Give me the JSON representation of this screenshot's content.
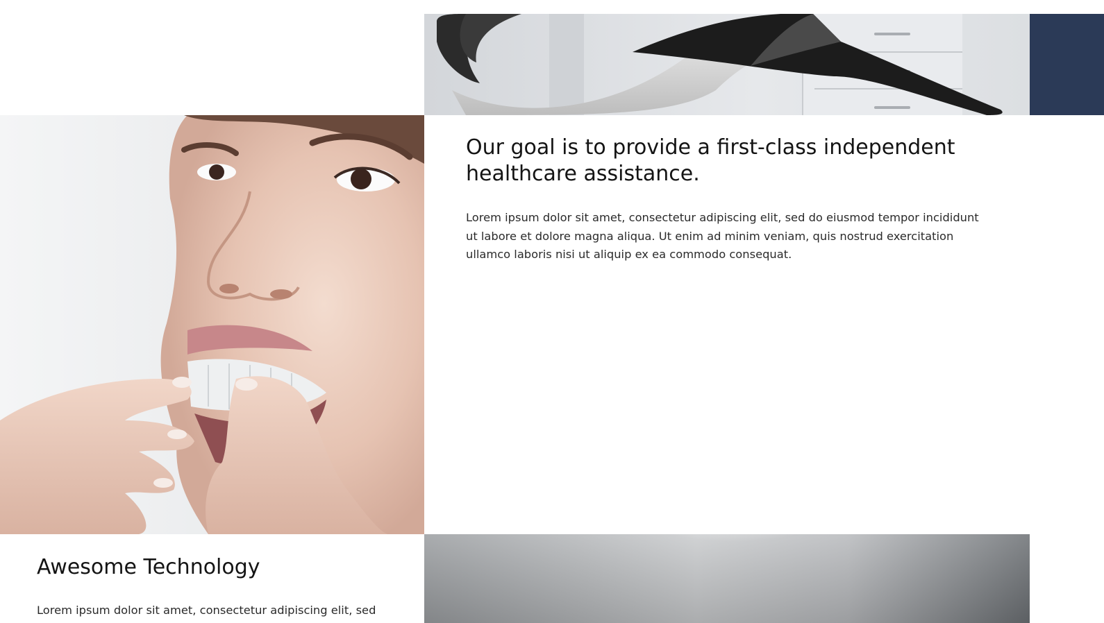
{
  "colors": {
    "accent_navy": "#2b3a57",
    "text_dark": "#141414",
    "text_body": "#2a2a2a",
    "background": "#ffffff"
  },
  "goal_section": {
    "heading": "Our goal is to provide a first-class independent healthcare assistance.",
    "body": "Lorem ipsum dolor sit amet, consectetur adipiscing elit, sed do eiusmod tempor incididunt ut labore et dolore magna aliqua. Ut enim ad minim veniam, quis nostrud exercitation ullamco laboris nisi ut aliquip ex ea commodo consequat."
  },
  "technology_section": {
    "heading": "Awesome Technology",
    "body": "Lorem ipsum dolor sit amet, consectetur adipiscing elit, sed"
  },
  "images": {
    "top": "dental-chair-photo",
    "left": "woman-inserting-aligner-photo",
    "bottom": "grey-closeup-photo"
  }
}
